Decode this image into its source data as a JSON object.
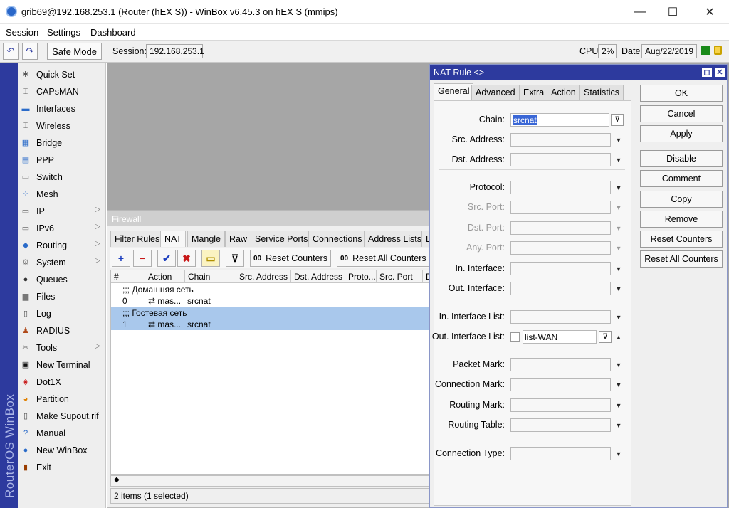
{
  "window": {
    "title": "grib69@192.168.253.1 (Router (hEX S)) - WinBox v6.45.3 on hEX S (mmips)",
    "minimize": "—",
    "maximize": "☐",
    "close": "✕"
  },
  "menubar": [
    "Session",
    "Settings",
    "Dashboard"
  ],
  "toolbar": {
    "undo": "↶",
    "redo": "↷",
    "safe_mode": "Safe Mode",
    "session_label": "Session:",
    "session_value": "192.168.253.1",
    "cpu_label": "CPU:",
    "cpu_value": "2%",
    "date_label": "Date:",
    "date_value": "Aug/22/2019"
  },
  "side_brand": "RouterOS WinBox",
  "sidebar": [
    {
      "label": "Quick Set",
      "icon": "wand-icon",
      "glyph": "✱"
    },
    {
      "label": "CAPsMAN",
      "icon": "antenna-icon",
      "glyph": "⌶"
    },
    {
      "label": "Interfaces",
      "icon": "interfaces-icon",
      "glyph": "▬"
    },
    {
      "label": "Wireless",
      "icon": "wireless-icon",
      "glyph": "⌶"
    },
    {
      "label": "Bridge",
      "icon": "bridge-icon",
      "glyph": "▦"
    },
    {
      "label": "PPP",
      "icon": "ppp-icon",
      "glyph": "▤"
    },
    {
      "label": "Switch",
      "icon": "switch-icon",
      "glyph": "▭"
    },
    {
      "label": "Mesh",
      "icon": "mesh-icon",
      "glyph": "⁘"
    },
    {
      "label": "IP",
      "icon": "ip-icon",
      "glyph": "▭",
      "arrow": "▷"
    },
    {
      "label": "IPv6",
      "icon": "ipv6-icon",
      "glyph": "▭",
      "arrow": "▷"
    },
    {
      "label": "Routing",
      "icon": "routing-icon",
      "glyph": "◆",
      "arrow": "▷"
    },
    {
      "label": "System",
      "icon": "gear-icon",
      "glyph": "⚙",
      "arrow": "▷"
    },
    {
      "label": "Queues",
      "icon": "queues-icon",
      "glyph": "●"
    },
    {
      "label": "Files",
      "icon": "folder-icon",
      "glyph": "▆"
    },
    {
      "label": "Log",
      "icon": "log-icon",
      "glyph": "▯"
    },
    {
      "label": "RADIUS",
      "icon": "radius-icon",
      "glyph": "♟"
    },
    {
      "label": "Tools",
      "icon": "tools-icon",
      "glyph": "✂",
      "arrow": "▷"
    },
    {
      "label": "New Terminal",
      "icon": "terminal-icon",
      "glyph": "▣"
    },
    {
      "label": "Dot1X",
      "icon": "dot1x-icon",
      "glyph": "◈"
    },
    {
      "label": "Partition",
      "icon": "partition-icon",
      "glyph": "◕"
    },
    {
      "label": "Make Supout.rif",
      "icon": "file-icon",
      "glyph": "▯"
    },
    {
      "label": "Manual",
      "icon": "help-icon",
      "glyph": "?"
    },
    {
      "label": "New WinBox",
      "icon": "winbox-icon",
      "glyph": "●"
    },
    {
      "label": "Exit",
      "icon": "exit-icon",
      "glyph": "▮"
    }
  ],
  "firewall": {
    "title": "Firewall",
    "tabs": [
      "Filter Rules",
      "NAT",
      "Mangle",
      "Raw",
      "Service Ports",
      "Connections",
      "Address Lists",
      "L"
    ],
    "toolbar": {
      "add": "+",
      "remove": "−",
      "enable": "✔",
      "disable": "✖",
      "comment": "▭",
      "filter": "⊽",
      "reset_counters": "Reset Counters",
      "reset_all_counters": "Reset All Counters",
      "counter_glyph": "00"
    },
    "columns": [
      "#",
      "Action",
      "Chain",
      "Src. Address",
      "Dst. Address",
      "Proto...",
      "Src. Port",
      "D"
    ],
    "rows": [
      {
        "comment": ";;; Домашняя сеть",
        "num": "0",
        "action": "⇄ mas...",
        "chain": "srcnat",
        "selected": false
      },
      {
        "comment": ";;; Гостевая сеть",
        "num": "1",
        "action": "⇄ mas...",
        "chain": "srcnat",
        "selected": true
      }
    ],
    "status": "2 items (1 selected)",
    "scroll_left": "◆"
  },
  "nat_rule": {
    "title": "NAT Rule <>",
    "tabs": [
      "General",
      "Advanced",
      "Extra",
      "Action",
      "Statistics"
    ],
    "fields": [
      {
        "label": "Chain:",
        "value": "srcnat",
        "disabled": false
      },
      {
        "label": "Src. Address:",
        "value": "",
        "disabled": false
      },
      {
        "label": "Dst. Address:",
        "value": "",
        "disabled": false
      },
      {
        "label": "Protocol:",
        "value": "",
        "disabled": false
      },
      {
        "label": "Src. Port:",
        "value": "",
        "disabled": true
      },
      {
        "label": "Dst. Port:",
        "value": "",
        "disabled": true
      },
      {
        "label": "Any. Port:",
        "value": "",
        "disabled": true
      },
      {
        "label": "In. Interface:",
        "value": "",
        "disabled": false
      },
      {
        "label": "Out. Interface:",
        "value": "",
        "disabled": false
      },
      {
        "label": "In. Interface List:",
        "value": "",
        "disabled": false
      },
      {
        "label": "Out. Interface List:",
        "value": "list-WAN",
        "disabled": false
      },
      {
        "label": "Packet Mark:",
        "value": "",
        "disabled": false
      },
      {
        "label": "Connection Mark:",
        "value": "",
        "disabled": false
      },
      {
        "label": "Routing Mark:",
        "value": "",
        "disabled": false
      },
      {
        "label": "Routing Table:",
        "value": "",
        "disabled": false
      },
      {
        "label": "Connection Type:",
        "value": "",
        "disabled": false
      }
    ],
    "buttons": [
      "OK",
      "Cancel",
      "Apply",
      "Disable",
      "Comment",
      "Copy",
      "Remove",
      "Reset Counters",
      "Reset All Counters"
    ],
    "dropdown_glyph": "▼",
    "up_glyph": "▲",
    "combo_glyph": "⊽",
    "window_restore": "◻",
    "window_close": "✕"
  },
  "colors": {
    "brand": "#2d3a9e",
    "selection": "#a9c8ec",
    "desk": "#a6a6a6"
  }
}
